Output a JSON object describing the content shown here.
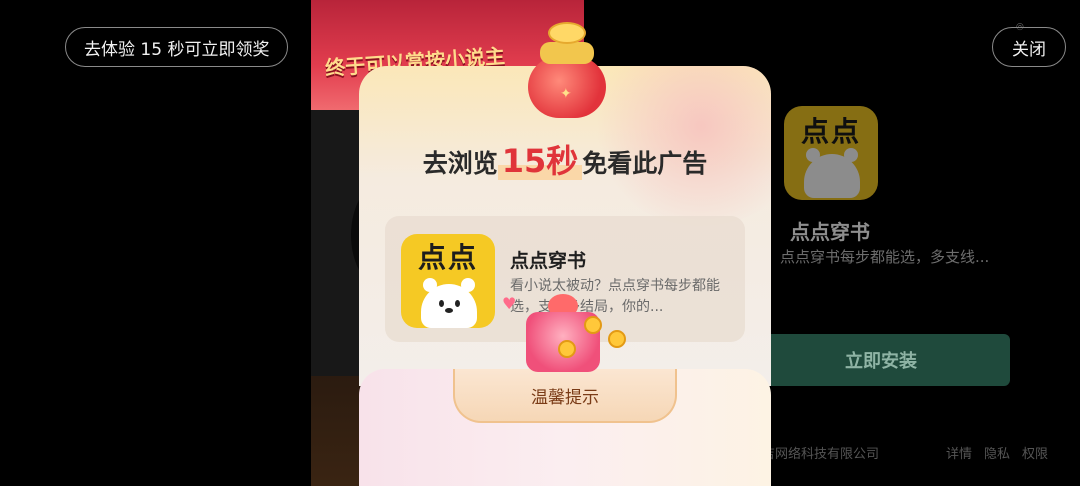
{
  "top": {
    "reward_pill": "去体验 15 秒可立即领奖",
    "close_label": "关闭"
  },
  "background_ad": {
    "banner_text": "终于可以赏按小说主"
  },
  "right_panel": {
    "logo_text": "点点",
    "app_name": "点点穿书",
    "app_desc": "点点穿书每步都能选，多支线...",
    "install_button": "立即安装",
    "company": "吉网络科技有限公司",
    "links": [
      "详情",
      "隐私",
      "权限"
    ]
  },
  "modal": {
    "title_prefix": "去浏览",
    "title_highlight": "15秒",
    "title_suffix": "免看此广告",
    "card": {
      "logo_text": "点点",
      "app_name": "点点穿书",
      "desc": "看小说太被动？点点穿书每步都能选，支线多结局，你的..."
    },
    "tip_label": "温馨提示"
  },
  "colors": {
    "highlight": "#e0343a",
    "install_button": "#1f4a3c",
    "logo_yellow": "#f5c924"
  },
  "icons": [
    "lucky-jar-icon",
    "gift-box-icon",
    "bear-logo-icon"
  ]
}
